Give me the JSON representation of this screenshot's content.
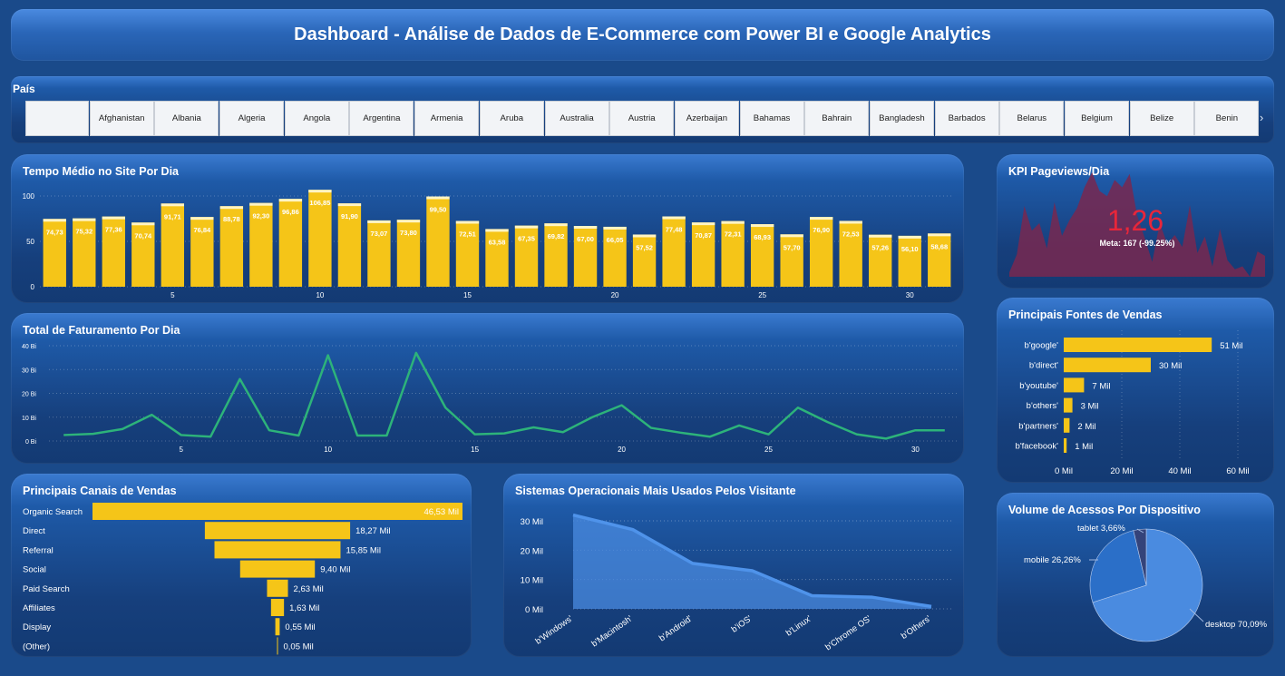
{
  "header": {
    "title": "Dashboard - Análise de Dados de E-Commerce com Power BI e Google Analytics"
  },
  "slicer": {
    "label": "País",
    "items": [
      "",
      "Afghanistan",
      "Albania",
      "Algeria",
      "Angola",
      "Argentina",
      "Armenia",
      "Aruba",
      "Australia",
      "Austria",
      "Azerbaijan",
      "Bahamas",
      "Bahrain",
      "Bangladesh",
      "Barbados",
      "Belarus",
      "Belgium",
      "Belize",
      "Benin"
    ],
    "scroll_icon": "chevron-right-icon"
  },
  "tempo": {
    "title": "Tempo Médio no Site Por Dia",
    "chart_data": {
      "type": "bar",
      "x": [
        1,
        2,
        3,
        4,
        5,
        6,
        7,
        8,
        9,
        10,
        11,
        12,
        13,
        14,
        15,
        16,
        17,
        18,
        19,
        20,
        21,
        22,
        23,
        24,
        25,
        26,
        27,
        28,
        29,
        30,
        31
      ],
      "values": [
        74.73,
        75.32,
        77.36,
        70.74,
        91.71,
        76.84,
        88.78,
        92.3,
        96.86,
        106.85,
        91.9,
        73.07,
        73.8,
        99.5,
        72.51,
        63.58,
        67.35,
        69.82,
        67.0,
        66.05,
        57.52,
        77.48,
        70.87,
        72.31,
        68.93,
        57.7,
        76.9,
        72.53,
        57.26,
        56.1,
        58.68
      ],
      "labels": [
        "74,73",
        "75,32",
        "77,36",
        "70,74",
        "91,71",
        "76,84",
        "88,78",
        "92,30",
        "96,86",
        "106,85",
        "91,90",
        "73,07",
        "73,80",
        "99,50",
        "72,51",
        "63,58",
        "67,35",
        "69,82",
        "67,00",
        "66,05",
        "57,52",
        "77,48",
        "70,87",
        "72,31",
        "68,93",
        "57,70",
        "76,90",
        "72,53",
        "57,26",
        "56,10",
        "58,68"
      ],
      "y_ticks": [
        "0",
        "50",
        "100"
      ],
      "x_ticks": [
        "5",
        "10",
        "15",
        "20",
        "25",
        "30"
      ],
      "ylim": [
        0,
        110
      ],
      "color": "#f5c518"
    }
  },
  "faturamento": {
    "title": "Total de Faturamento Por Dia",
    "chart_data": {
      "type": "line",
      "x": [
        1,
        2,
        3,
        4,
        5,
        6,
        7,
        8,
        9,
        10,
        11,
        12,
        13,
        14,
        15,
        16,
        17,
        18,
        19,
        20,
        21,
        22,
        23,
        24,
        25,
        26,
        27,
        28,
        29,
        30,
        31
      ],
      "values": [
        2.5,
        3,
        5,
        11,
        2.5,
        1.8,
        26,
        4.5,
        2.3,
        36,
        2.3,
        2.3,
        37,
        14,
        2.8,
        3.2,
        5.7,
        3.7,
        10,
        15,
        5.5,
        3.5,
        1.8,
        6.5,
        2.8,
        14,
        8,
        2.8,
        1,
        4.5,
        4.5
      ],
      "y_ticks": [
        "0 Bi",
        "10 Bi",
        "20 Bi",
        "30 Bi",
        "40 Bi"
      ],
      "x_ticks": [
        "5",
        "10",
        "15",
        "20",
        "25",
        "30"
      ],
      "ylim": [
        0,
        40
      ],
      "color": "#2db37a"
    }
  },
  "canais": {
    "title": "Principais Canais de Vendas",
    "chart_data": {
      "type": "bar",
      "categories": [
        "Organic Search",
        "Direct",
        "Referral",
        "Social",
        "Paid Search",
        "Affiliates",
        "Display",
        "(Other)"
      ],
      "values": [
        46.53,
        18.27,
        15.85,
        9.4,
        2.63,
        1.63,
        0.55,
        0.05
      ],
      "labels": [
        "46,53 Mil",
        "18,27 Mil",
        "15,85 Mil",
        "9,40 Mil",
        "2,63 Mil",
        "1,63 Mil",
        "0,55 Mil",
        "0,05 Mil"
      ],
      "color": "#f5c518"
    }
  },
  "so": {
    "title": "Sistemas Operacionais Mais Usados Pelos Visitante",
    "chart_data": {
      "type": "area",
      "categories": [
        "b'Windows'",
        "b'Macintosh'",
        "b'Android'",
        "b'iOS'",
        "b'Linux'",
        "b'Chrome OS'",
        "b'Others'"
      ],
      "values": [
        32,
        27,
        15.5,
        13,
        4.5,
        4,
        0.8
      ],
      "y_ticks": [
        "0 Mil",
        "10 Mil",
        "20 Mil",
        "30 Mil"
      ],
      "ylim": [
        0,
        33
      ],
      "color": "#4a8be0"
    }
  },
  "kpi": {
    "title": "KPI Pageviews/Dia",
    "value": "1,26",
    "meta": "Meta: 167 (-99.25%)",
    "trend": [
      6,
      30,
      95,
      62,
      72,
      38,
      100,
      55,
      76,
      92,
      120,
      140,
      115,
      108,
      130,
      120,
      138,
      82,
      52,
      20,
      72,
      44,
      56,
      40,
      96,
      32,
      54,
      14,
      64,
      22,
      10,
      14,
      0,
      34,
      28
    ],
    "value_color": "#e8263a"
  },
  "fontes": {
    "title": "Principais Fontes de Vendas",
    "chart_data": {
      "type": "bar",
      "categories": [
        "b'google'",
        "b'direct'",
        "b'youtube'",
        "b'others'",
        "b'partners'",
        "b'facebook'"
      ],
      "values": [
        51,
        30,
        7,
        3,
        2,
        1
      ],
      "labels": [
        "51 Mil",
        "30 Mil",
        "7 Mil",
        "3 Mil",
        "2 Mil",
        "1 Mil"
      ],
      "x_ticks": [
        "0 Mil",
        "20 Mil",
        "40 Mil",
        "60 Mil"
      ],
      "xlim": [
        0,
        60
      ],
      "color": "#f5c518"
    }
  },
  "dispositivo": {
    "title": "Volume de Acessos Por Dispositivo",
    "chart_data": {
      "type": "pie",
      "categories": [
        "desktop",
        "mobile",
        "tablet"
      ],
      "values": [
        70.09,
        26.26,
        3.66
      ],
      "labels": [
        "desktop 70,09%",
        "mobile 26,26%",
        "tablet 3,66%"
      ],
      "colors": [
        "#4a8be0",
        "#2b6fc8",
        "#34437a"
      ]
    }
  }
}
